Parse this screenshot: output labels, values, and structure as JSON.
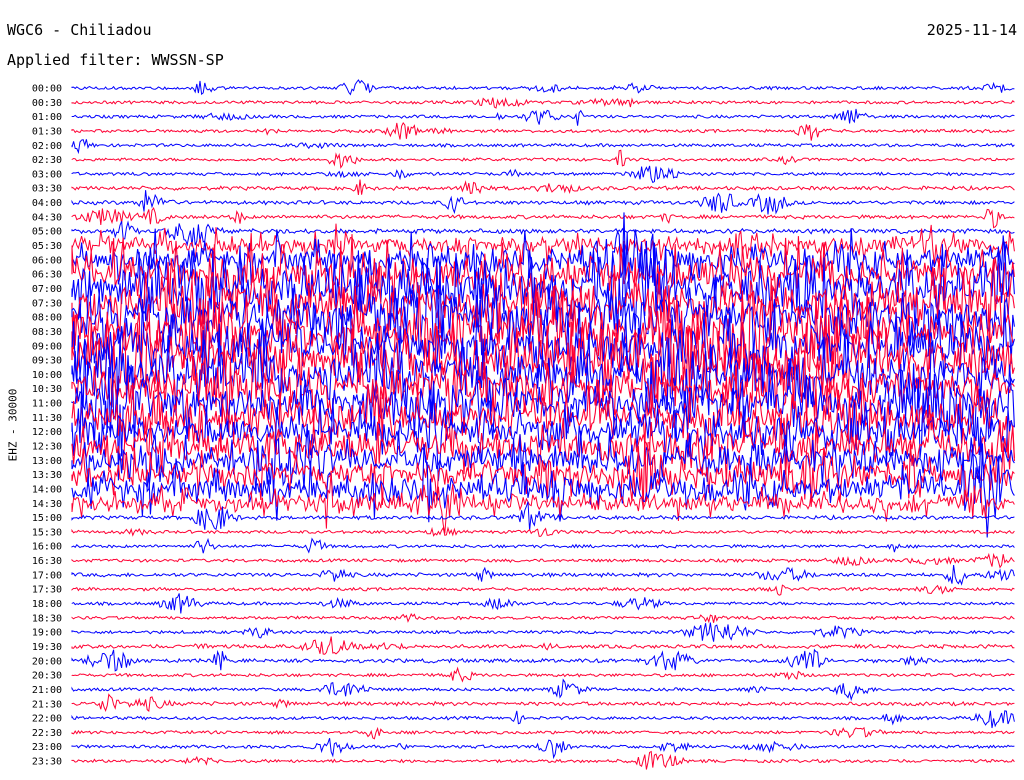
{
  "header": {
    "station": "WGC6 - Chiliadou",
    "date": "2025-11-14",
    "filter": "Applied filter: WWSSN-SP"
  },
  "colors": {
    "blue": "#0000ff",
    "red": "#ff0033"
  },
  "chart_data": {
    "type": "line",
    "title": "WGC6 - Chiliadou",
    "subtitle": "Applied filter: WWSSN-SP",
    "ylabel": "EHZ - 30000",
    "xlabel": "",
    "row_labels": [
      "00:00",
      "00:30",
      "01:00",
      "01:30",
      "02:00",
      "02:30",
      "03:00",
      "03:30",
      "04:00",
      "04:30",
      "05:00",
      "05:30",
      "06:00",
      "06:30",
      "07:00",
      "07:30",
      "08:00",
      "08:30",
      "09:00",
      "09:30",
      "10:00",
      "10:30",
      "11:00",
      "11:30",
      "12:00",
      "12:30",
      "13:00",
      "13:30",
      "14:00",
      "14:30",
      "15:00",
      "15:30",
      "16:00",
      "16:30",
      "17:00",
      "17:30",
      "18:00",
      "18:30",
      "19:00",
      "19:30",
      "20:00",
      "20:30",
      "21:00",
      "21:30",
      "22:00",
      "22:30",
      "23:00",
      "23:30"
    ],
    "series_colors": [
      "blue",
      "red"
    ],
    "activity_level": [
      1,
      1,
      1,
      1,
      1,
      1,
      1,
      2,
      2,
      2,
      3,
      4,
      6,
      8,
      9,
      9,
      9,
      9,
      9,
      9,
      9,
      8,
      8,
      8,
      7,
      7,
      6,
      6,
      6,
      4,
      2,
      1,
      1,
      1,
      2,
      1,
      1,
      1,
      1,
      2,
      2,
      1,
      1,
      2,
      1,
      1,
      1,
      1
    ],
    "grid": false
  }
}
